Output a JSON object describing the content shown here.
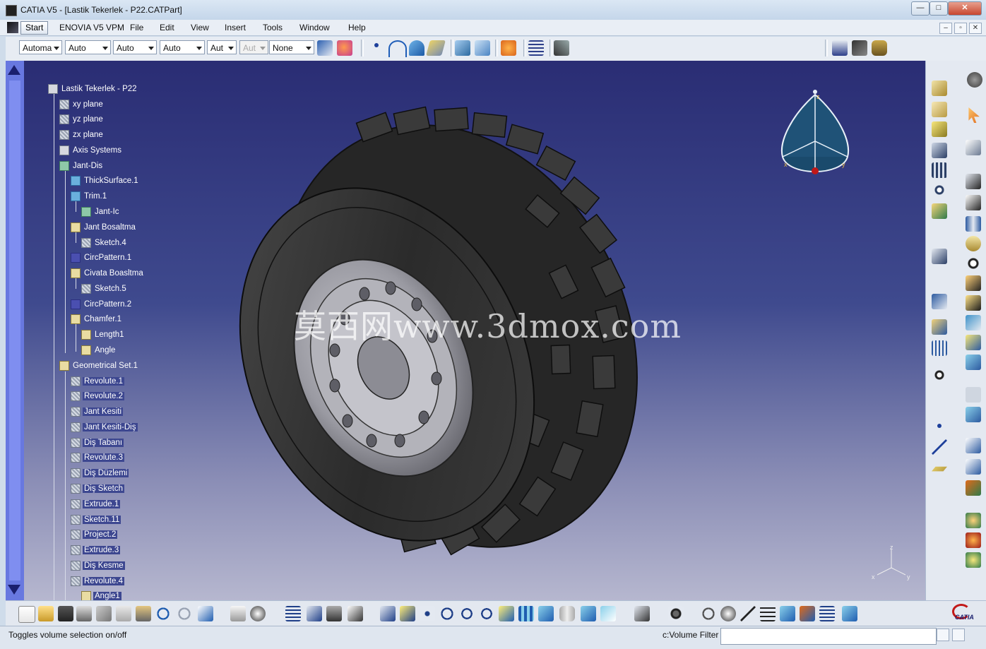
{
  "window": {
    "title": "CATIA V5 - [Lastik Tekerlek - P22.CATPart]",
    "minimize": "—",
    "maximize": "□",
    "close": "✕"
  },
  "menubar": {
    "items": [
      "Start",
      "ENOVIA V5 VPM",
      "File",
      "Edit",
      "View",
      "Insert",
      "Tools",
      "Window",
      "Help"
    ],
    "doc_buttons": [
      "–",
      "▫",
      "✕"
    ]
  },
  "toolbar": {
    "combos": [
      "Automa",
      "Auto",
      "Auto",
      "Auto",
      "Aut",
      "Aut",
      "None"
    ],
    "combo_disabled_index": 5
  },
  "tree": {
    "items": [
      {
        "label": "Lastik Tekerlek - P22",
        "icon": "part-icon",
        "hl": false
      },
      {
        "label": "xy plane",
        "icon": "plane-icon",
        "hl": false
      },
      {
        "label": "yz plane",
        "icon": "plane-icon",
        "hl": false
      },
      {
        "label": "zx plane",
        "icon": "plane-icon",
        "hl": false
      },
      {
        "label": "Axis Systems",
        "icon": "axis-systems-icon",
        "hl": false
      },
      {
        "label": "Jant-Dis",
        "icon": "body-icon",
        "hl": false
      },
      {
        "label": "ThickSurface.1",
        "icon": "thicksurface-icon",
        "hl": false
      },
      {
        "label": "Trim.1",
        "icon": "trim-icon",
        "hl": false
      },
      {
        "label": "Jant-Ic",
        "icon": "body-icon",
        "hl": false
      },
      {
        "label": "Jant Bosaltma",
        "icon": "pocket-icon",
        "hl": false
      },
      {
        "label": "Sketch.4",
        "icon": "sketch-icon",
        "hl": false
      },
      {
        "label": "CircPattern.1",
        "icon": "circ-pattern-icon",
        "hl": false
      },
      {
        "label": "Civata Boasltma",
        "icon": "pocket-icon",
        "hl": false
      },
      {
        "label": "Sketch.5",
        "icon": "sketch-icon",
        "hl": false
      },
      {
        "label": "CircPattern.2",
        "icon": "circ-pattern-icon",
        "hl": false
      },
      {
        "label": "Chamfer.1",
        "icon": "chamfer-icon",
        "hl": false
      },
      {
        "label": "Length1",
        "icon": "parameter-icon",
        "hl": false
      },
      {
        "label": "Angle",
        "icon": "parameter-icon",
        "hl": false
      },
      {
        "label": "Geometrical Set.1",
        "icon": "geometrical-set-icon",
        "hl": false
      },
      {
        "label": "Revolute.1",
        "icon": "revolute-icon",
        "hl": true
      },
      {
        "label": "Revolute.2",
        "icon": "revolute-icon",
        "hl": true
      },
      {
        "label": "Jant Kesiti",
        "icon": "sketch-icon",
        "hl": true
      },
      {
        "label": "Jant Kesiti-Diş",
        "icon": "sketch-icon",
        "hl": true
      },
      {
        "label": "Diş Tabanı",
        "icon": "sketch-icon",
        "hl": true
      },
      {
        "label": "Revolute.3",
        "icon": "revolute-icon",
        "hl": true
      },
      {
        "label": "Diş Düzlemi",
        "icon": "plane-icon",
        "hl": true
      },
      {
        "label": "Diş Sketch",
        "icon": "sketch-icon",
        "hl": true
      },
      {
        "label": "Extrude.1",
        "icon": "extrude-icon",
        "hl": true
      },
      {
        "label": "Sketch.11",
        "icon": "sketch-icon",
        "hl": true
      },
      {
        "label": "Project.2",
        "icon": "project-icon",
        "hl": true
      },
      {
        "label": "Extrude.3",
        "icon": "extrude-icon",
        "hl": true
      },
      {
        "label": "Diş Kesme",
        "icon": "split-icon",
        "hl": true
      },
      {
        "label": "Revolute.4",
        "icon": "revolute-icon",
        "hl": true
      },
      {
        "label": "Angle1",
        "icon": "parameter-icon",
        "hl": true
      }
    ]
  },
  "compass": {
    "labels": [
      "z",
      "x",
      "y"
    ]
  },
  "axis_triad": {
    "labels": [
      "z",
      "x",
      "y"
    ]
  },
  "watermark": "莫西网www.3dmox.com",
  "status": {
    "message": "Toggles volume selection on/off",
    "command_label": "c:Volume Filter",
    "command_value": ""
  },
  "brand": "CATIA",
  "colors": {
    "viewport_top": "#2a2d74",
    "viewport_bottom": "#b6b7cf",
    "tree_highlight": "#3d4790",
    "left_scroll": "#6878e0"
  }
}
